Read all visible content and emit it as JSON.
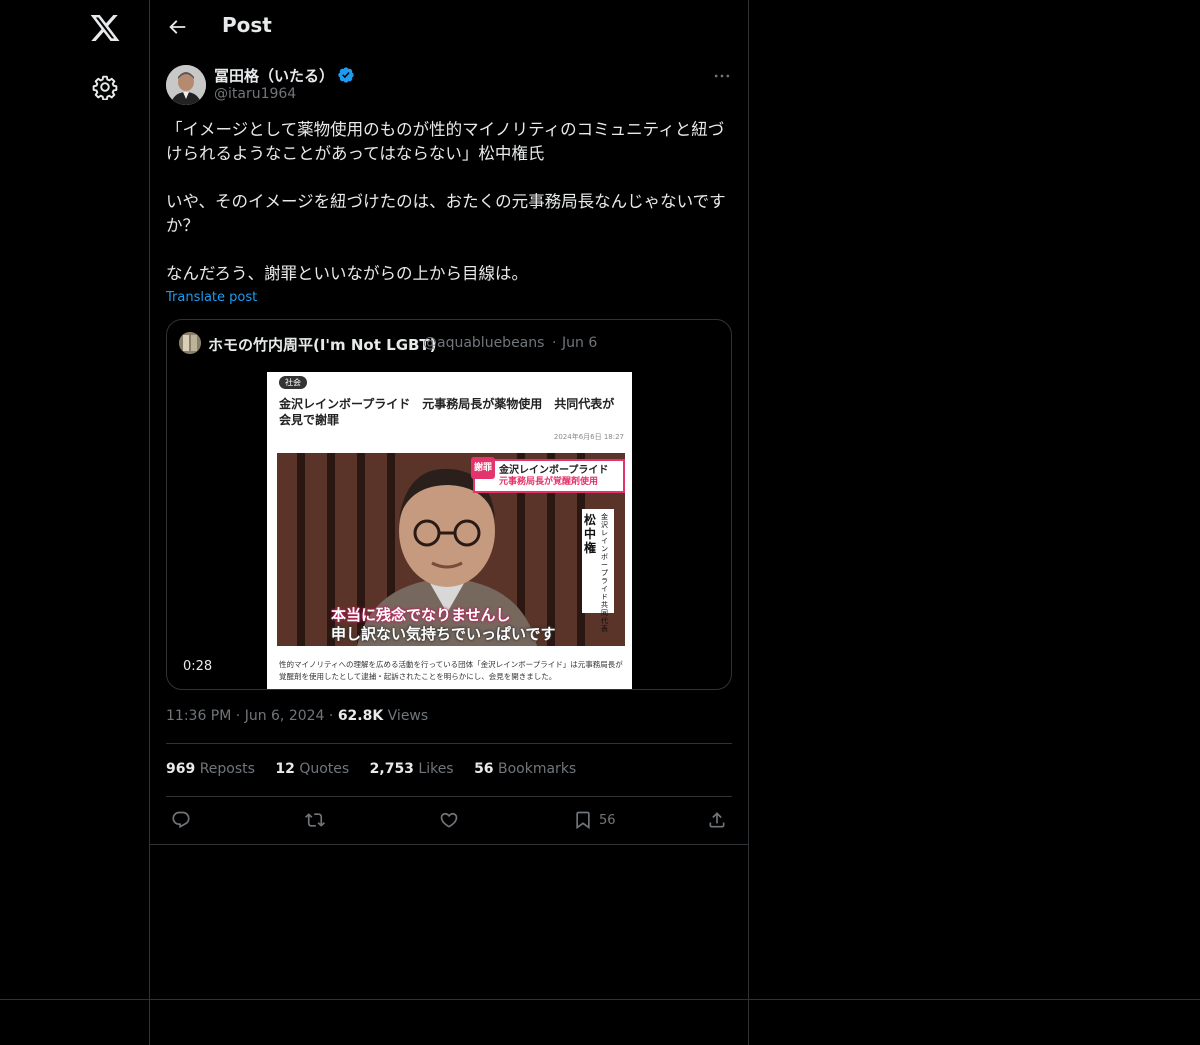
{
  "header": {
    "title": "Post"
  },
  "author": {
    "name": "冨田格（いたる）",
    "handle": "@itaru1964"
  },
  "tweet": {
    "text": "「イメージとして薬物使用のものが性的マイノリティのコミュニティと紐づけられるようなことがあってはならない」松中権氏\n\nいや、そのイメージを紐づけたのは、おたくの元事務局長なんじゃないですか？\n\nなんだろう、謝罪といいながらの上から目線は。",
    "translate_label": "Translate post"
  },
  "quote": {
    "name": "ホモの竹内周平(I'm Not LGBT)",
    "handle": "@aquabluebeans",
    "separator": "·",
    "date": "Jun 6",
    "video_duration": "0:28",
    "article": {
      "badge": "社会",
      "title": "金沢レインボープライド　元事務局長が薬物使用　共同代表が会見で謝罪",
      "date": "2024年6月6日 18:27",
      "tag_red": "謝罪",
      "tag_line1": "金沢レインボープライド",
      "tag_line2": "元事務局長が覚醒剤使用",
      "nameplate_big": "松中権",
      "nameplate_small": "金沢レインボープライド共同代表",
      "caption_line1": "本当に残念でなりませんし",
      "caption_line2": "申し訳ない気持ちでいっぱいです",
      "body": "性的マイノリティへの理解を広める活動を行っている団体「金沢レインボープライド」は元事務局長が覚醒剤を使用したとして逮捕・起訴されたことを明らかにし、会見を開きました。"
    }
  },
  "meta": {
    "time": "11:36 PM",
    "sep1": "·",
    "date": "Jun 6, 2024",
    "sep2": "·",
    "views_count": "62.8K",
    "views_label": "Views"
  },
  "stats": {
    "reposts_count": "969",
    "reposts_label": "Reposts",
    "quotes_count": "12",
    "quotes_label": "Quotes",
    "likes_count": "2,753",
    "likes_label": "Likes",
    "bookmarks_count": "56",
    "bookmarks_label": "Bookmarks"
  },
  "actions": {
    "bookmark_count": "56"
  },
  "colors": {
    "accent": "#1d9bf0",
    "background": "#000000",
    "text": "#e7e9ea",
    "muted": "#71767b",
    "border": "#2f3336"
  }
}
